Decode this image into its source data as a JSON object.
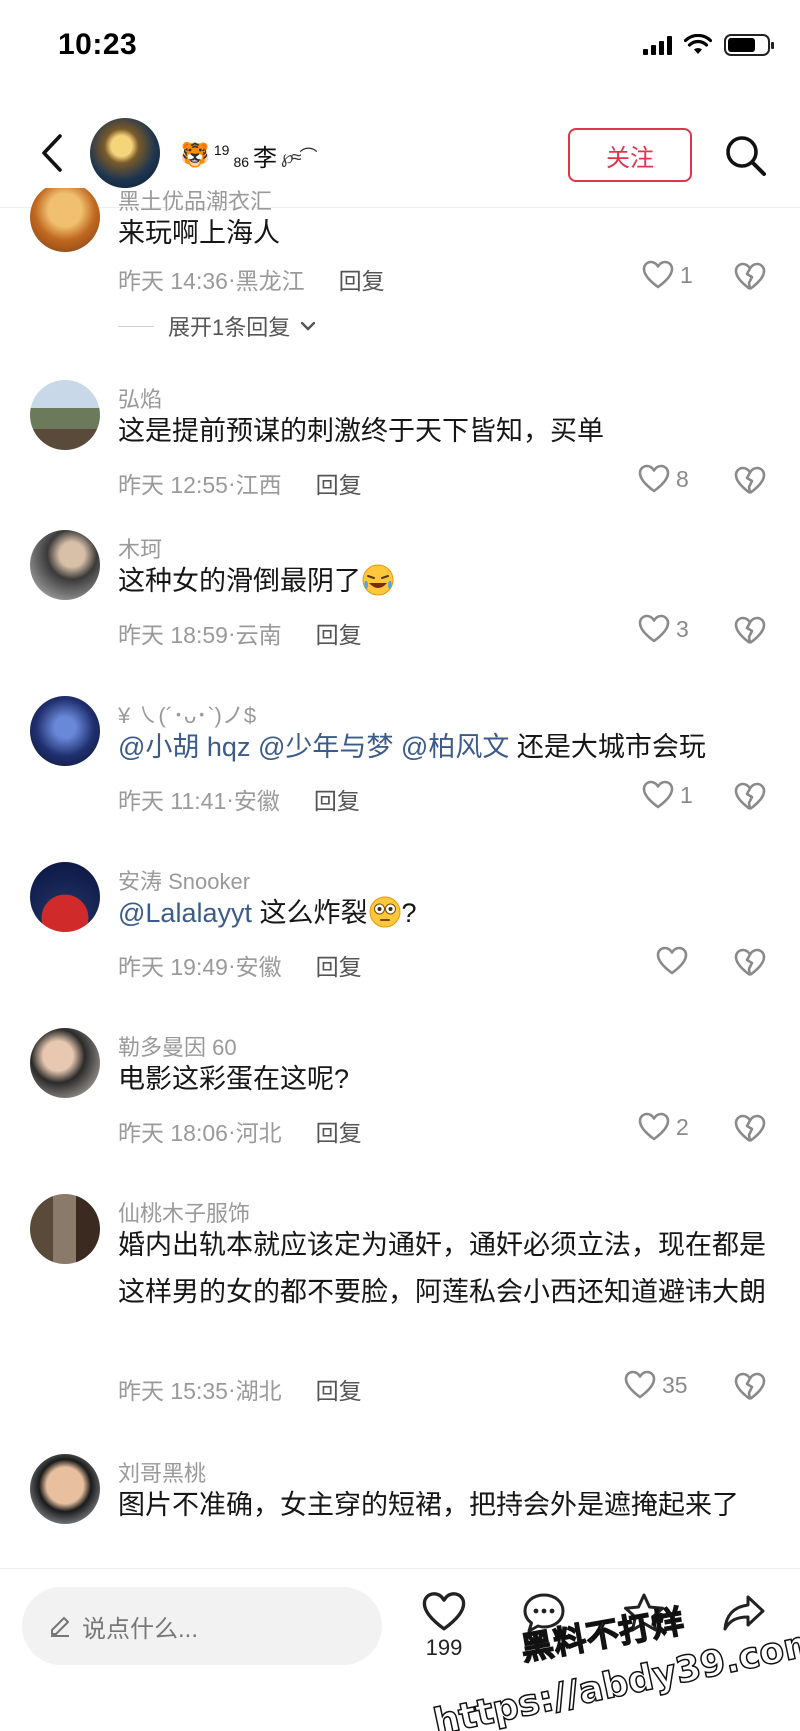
{
  "status_bar": {
    "time": "10:23"
  },
  "header": {
    "name_emoji": "🐯",
    "name_sup": "19",
    "name_sub": "86",
    "name_text": "李",
    "name_deco": "℘≈⌒",
    "follow_label": "关注"
  },
  "comments": [
    {
      "user": "黑土优品潮衣汇",
      "text": "来玩啊上海人",
      "time": "昨天 14:36",
      "location": "黑龙江",
      "reply_label": "回复",
      "likes": "1",
      "expand": "展开1条回复"
    },
    {
      "user": "弘焰",
      "text": "这是提前预谋的刺激终于天下皆知，买单",
      "time": "昨天 12:55",
      "location": "江西",
      "reply_label": "回复",
      "likes": "8"
    },
    {
      "user": "木珂",
      "text": "这种女的滑倒最阴了",
      "time": "昨天 18:59",
      "location": "云南",
      "reply_label": "回复",
      "likes": "3"
    },
    {
      "user": "¥ ㇏(´･ᴗ･`)ノ$",
      "mentions": [
        "@小胡 hqz",
        "@少年与梦",
        "@柏风文"
      ],
      "text": " 还是大城市会玩",
      "time": "昨天 11:41",
      "location": "安徽",
      "reply_label": "回复",
      "likes": "1"
    },
    {
      "user": "安涛 Snooker",
      "mentions": [
        "@Lalalayyt"
      ],
      "text": " 这么炸裂",
      "text_suffix": "?",
      "time": "昨天 19:49",
      "location": "安徽",
      "reply_label": "回复",
      "likes": ""
    },
    {
      "user": "勒多曼因 60",
      "text": "电影这彩蛋在这呢?",
      "time": "昨天 18:06",
      "location": "河北",
      "reply_label": "回复",
      "likes": "2"
    },
    {
      "user": "仙桃木子服饰",
      "text": "婚内出轨本就应该定为通奸，通奸必须立法，现在都是这样男的女的都不要脸，阿莲私会小西还知道避讳大朗",
      "time": "昨天 15:35",
      "location": "湖北",
      "reply_label": "回复",
      "likes": "35"
    },
    {
      "user": "刘哥黑桃",
      "text": "图片不准确，女主穿的短裙，把持会外是遮掩起来了"
    }
  ],
  "bottom_bar": {
    "input_placeholder": "说点什么...",
    "like_count": "199"
  },
  "watermark": {
    "cn": "黑料不打烊",
    "url": "https://abdy39.com"
  },
  "colors": {
    "accent": "#e0344e",
    "mention": "#3b5b8a",
    "meta_text": "#9a9a9a"
  },
  "icons": {
    "back": "chevron-left-icon",
    "search": "search-icon",
    "like": "heart-icon",
    "dislike": "broken-heart-icon",
    "comment": "chat-bubble-icon",
    "favorite": "star-icon",
    "share": "share-arrow-icon",
    "edit": "pencil-icon"
  }
}
